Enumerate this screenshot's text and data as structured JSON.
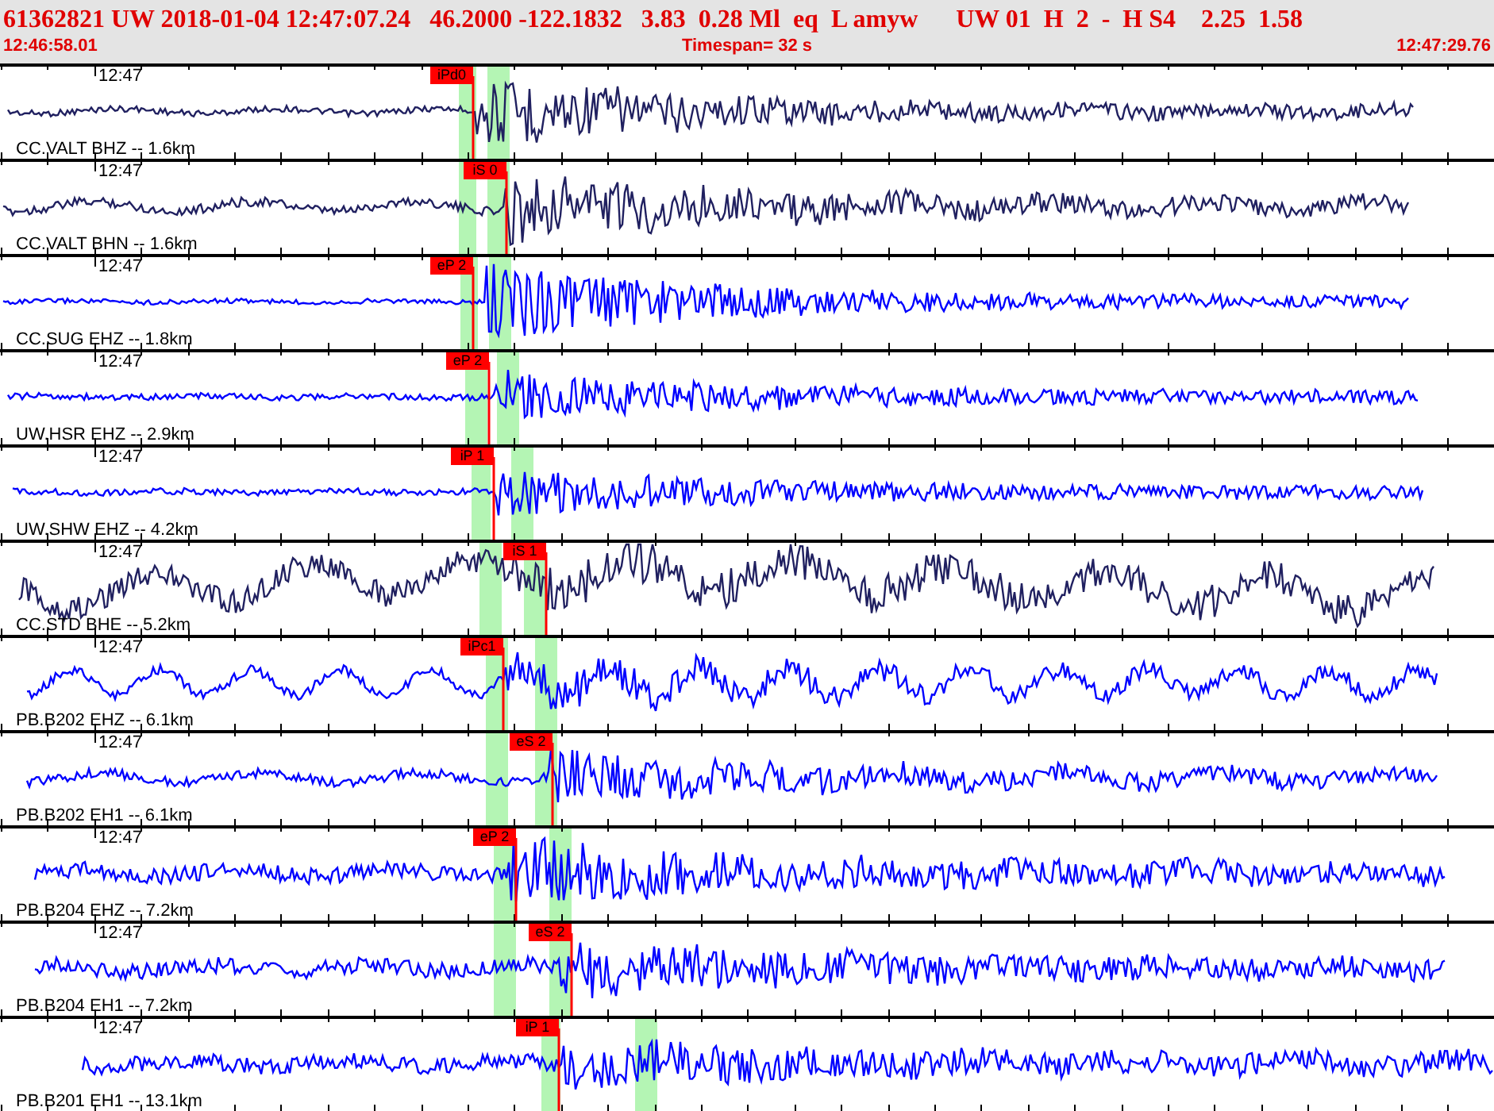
{
  "header": {
    "event_line": "61362821 UW 2018-01-04 12:47:07.24   46.2000 -122.1832   3.83  0.28 Ml  eq  L amyw      UW 01  H  2  -  H S4    2.25  1.58",
    "start_time": "12:46:58.01",
    "timespan": "Timespan=  32 s",
    "end_time": "12:47:29.76"
  },
  "traces": [
    {
      "time_label": "12:47",
      "station": "CC.VALT BHZ -- 1.6km",
      "pick": "iPd0",
      "color": "#202060"
    },
    {
      "time_label": "12:47",
      "station": "CC.VALT BHN -- 1.6km",
      "pick": "iS 0",
      "color": "#202060"
    },
    {
      "time_label": "12:47",
      "station": "CC.SUG EHZ -- 1.8km",
      "pick": "eP 2",
      "color": "#0000ff"
    },
    {
      "time_label": "12:47",
      "station": "UW.HSR EHZ -- 2.9km",
      "pick": "eP 2",
      "color": "#0000ff"
    },
    {
      "time_label": "12:47",
      "station": "UW.SHW EHZ -- 4.2km",
      "pick": "iP 1",
      "color": "#0000ff"
    },
    {
      "time_label": "12:47",
      "station": "CC.STD BHE -- 5.2km",
      "pick": "iS 1",
      "color": "#202060"
    },
    {
      "time_label": "12:47",
      "station": "PB.B202 EHZ -- 6.1km",
      "pick": "iPc1",
      "color": "#0000ff"
    },
    {
      "time_label": "12:47",
      "station": "PB.B202 EH1 -- 6.1km",
      "pick": "eS 2",
      "color": "#0000ff"
    },
    {
      "time_label": "12:47",
      "station": "PB.B204 EHZ -- 7.2km",
      "pick": "eP 2",
      "color": "#0000ff"
    },
    {
      "time_label": "12:47",
      "station": "PB.B204 EH1 -- 7.2km",
      "pick": "eS 2",
      "color": "#0000ff"
    },
    {
      "time_label": "12:47",
      "station": "PB.B201 EH1 -- 13.1km",
      "pick": "iP 1",
      "color": "#0000ff"
    }
  ]
}
